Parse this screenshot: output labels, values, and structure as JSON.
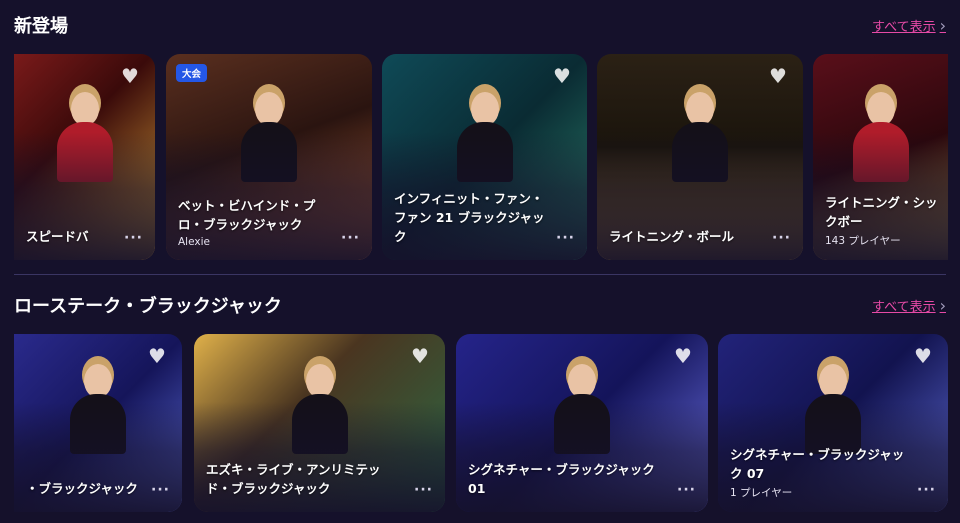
{
  "sections": [
    {
      "title": "新登場",
      "view_all": "すべて表示",
      "cards": [
        {
          "title": "スピードバ",
          "sub": "",
          "bg": "#7a1a1a",
          "bg2": "#d6a13a"
        },
        {
          "title": "ベット・ビハインド・プロ・ブラックジャック",
          "sub": "Alexie",
          "badge": "大会",
          "bg": "#5a2f1f",
          "bg2": "#b7653a"
        },
        {
          "title": "インフィニット・ファン・ファン 21 ブラックジャック",
          "sub": "",
          "bg": "#0f4a57",
          "bg2": "#2a7f6a"
        },
        {
          "title": "ライトニング・ボール",
          "sub": "",
          "bg": "#2b2115",
          "bg2": "#a47c2f"
        },
        {
          "title": "ライトニング・シックボー",
          "sub": "143 プレイヤー",
          "bg": "#5a0f1a",
          "bg2": "#c7a044"
        }
      ]
    },
    {
      "title": "ローステーク・ブラックジャック",
      "view_all": "すべて表示",
      "cards": [
        {
          "title": "・ブラックジャック",
          "sub": "",
          "bg": "#2a2a8c",
          "bg2": "#5c6bd6"
        },
        {
          "title": "エズキ・ライブ・アンリミテッド・ブラックジャック",
          "sub": "",
          "bg": "#4a3520",
          "bg2": "#e0b14a"
        },
        {
          "title": "シグネチャー・ブラックジャック 01",
          "sub": "",
          "bg": "#25248a",
          "bg2": "#6a6fe0"
        },
        {
          "title": "シグネチャー・ブラックジャック 07",
          "sub": "1 プレイヤー",
          "bg": "#22237a",
          "bg2": "#5d6ad4"
        },
        {
          "title": "",
          "sub": "",
          "bg": "#24207a",
          "bg2": "#5b57c9"
        }
      ]
    }
  ],
  "icons": {
    "heart": "heart-icon",
    "more": "more-options-icon",
    "chevron": "chevron-right-icon"
  }
}
